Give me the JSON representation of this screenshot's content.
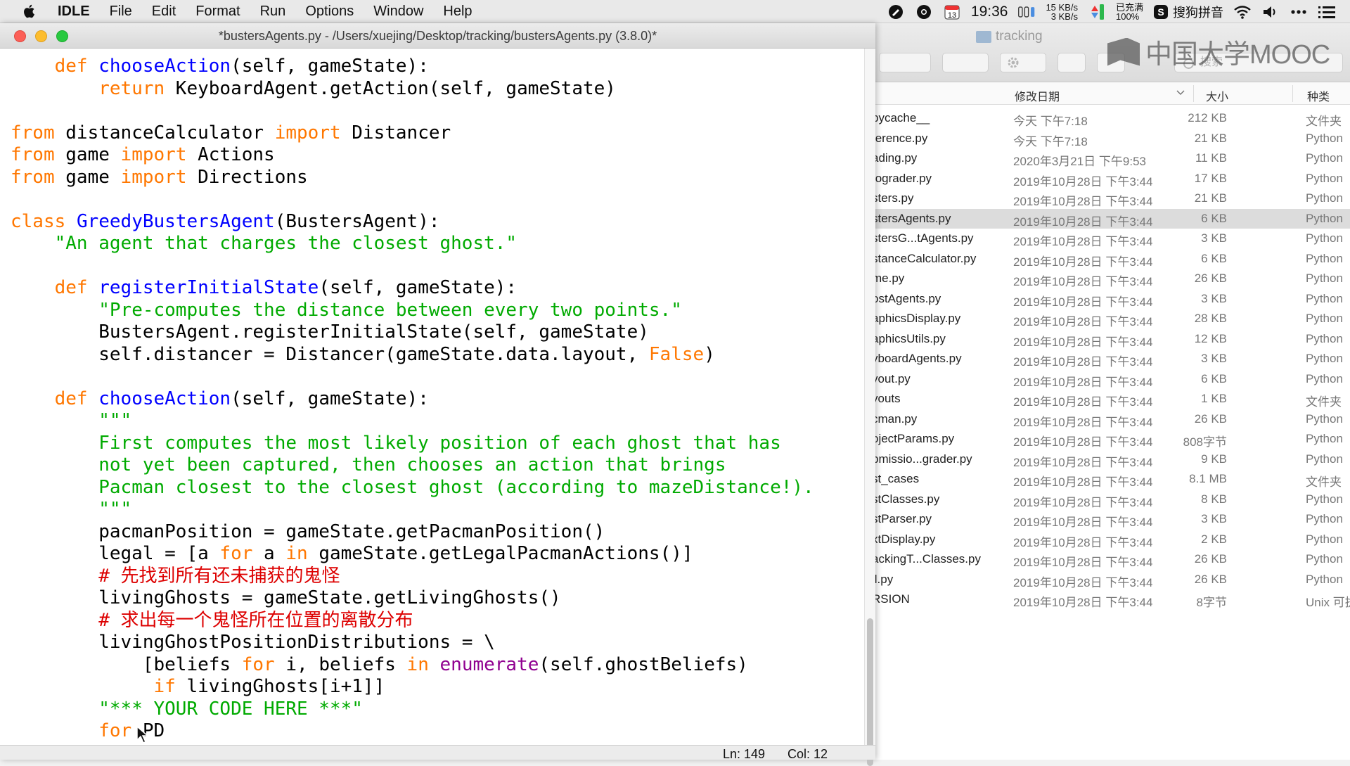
{
  "menubar": {
    "apple_icon": "apple-logo-icon",
    "app_name": "IDLE",
    "menus": [
      "File",
      "Edit",
      "Format",
      "Run",
      "Options",
      "Window",
      "Help"
    ],
    "calendar_day": "13",
    "clock": "19:36",
    "net_up": "15 KB/s",
    "net_down": "3 KB/s",
    "battery_status": "已充满",
    "battery_percent": "100%",
    "ime_label": "搜狗拼音",
    "icons": [
      "pen-icon",
      "chrome-icon",
      "calendar-icon",
      "memory-icon",
      "network-icon",
      "battery-icon",
      "sogou-icon",
      "wifi-icon",
      "volume-icon",
      "more-icon",
      "list-icon"
    ]
  },
  "finder": {
    "title": "tracking",
    "search_placeholder": "搜索",
    "columns": {
      "date": "修改日期",
      "size": "大小",
      "kind": "种类"
    },
    "rows": [
      {
        "name": "pycache__",
        "date": "今天 下午7:18",
        "size": "212 KB",
        "kind": "文件夹"
      },
      {
        "name": "ference.py",
        "date": "今天 下午7:18",
        "size": "21 KB",
        "kind": "Python"
      },
      {
        "name": "ading.py",
        "date": "2020年3月21日 下午9:53",
        "size": "11 KB",
        "kind": "Python"
      },
      {
        "name": "tograder.py",
        "date": "2019年10月28日 下午3:44",
        "size": "17 KB",
        "kind": "Python"
      },
      {
        "name": "sters.py",
        "date": "2019年10月28日 下午3:44",
        "size": "21 KB",
        "kind": "Python"
      },
      {
        "name": "stersAgents.py",
        "date": "2019年10月28日 下午3:44",
        "size": "6 KB",
        "kind": "Python",
        "selected": true
      },
      {
        "name": "stersG...tAgents.py",
        "date": "2019年10月28日 下午3:44",
        "size": "3 KB",
        "kind": "Python"
      },
      {
        "name": "stanceCalculator.py",
        "date": "2019年10月28日 下午3:44",
        "size": "6 KB",
        "kind": "Python"
      },
      {
        "name": "me.py",
        "date": "2019年10月28日 下午3:44",
        "size": "26 KB",
        "kind": "Python"
      },
      {
        "name": "ostAgents.py",
        "date": "2019年10月28日 下午3:44",
        "size": "3 KB",
        "kind": "Python"
      },
      {
        "name": "aphicsDisplay.py",
        "date": "2019年10月28日 下午3:44",
        "size": "28 KB",
        "kind": "Python"
      },
      {
        "name": "aphicsUtils.py",
        "date": "2019年10月28日 下午3:44",
        "size": "12 KB",
        "kind": "Python"
      },
      {
        "name": "yboardAgents.py",
        "date": "2019年10月28日 下午3:44",
        "size": "3 KB",
        "kind": "Python"
      },
      {
        "name": "yout.py",
        "date": "2019年10月28日 下午3:44",
        "size": "6 KB",
        "kind": "Python"
      },
      {
        "name": "youts",
        "date": "2019年10月28日 下午3:44",
        "size": "1 KB",
        "kind": "文件夹"
      },
      {
        "name": "cman.py",
        "date": "2019年10月28日 下午3:44",
        "size": "26 KB",
        "kind": "Python"
      },
      {
        "name": "ojectParams.py",
        "date": "2019年10月28日 下午3:44",
        "size": "808字节",
        "kind": "Python"
      },
      {
        "name": "bmissio...grader.py",
        "date": "2019年10月28日 下午3:44",
        "size": "9 KB",
        "kind": "Python"
      },
      {
        "name": "st_cases",
        "date": "2019年10月28日 下午3:44",
        "size": "8.1 MB",
        "kind": "文件夹"
      },
      {
        "name": "stClasses.py",
        "date": "2019年10月28日 下午3:44",
        "size": "8 KB",
        "kind": "Python"
      },
      {
        "name": "stParser.py",
        "date": "2019年10月28日 下午3:44",
        "size": "3 KB",
        "kind": "Python"
      },
      {
        "name": "xtDisplay.py",
        "date": "2019年10月28日 下午3:44",
        "size": "2 KB",
        "kind": "Python"
      },
      {
        "name": "ackingT...Classes.py",
        "date": "2019年10月28日 下午3:44",
        "size": "26 KB",
        "kind": "Python"
      },
      {
        "name": "il.py",
        "date": "2019年10月28日 下午3:44",
        "size": "26 KB",
        "kind": "Python"
      },
      {
        "name": "RSION",
        "date": "2019年10月28日 下午3:44",
        "size": "8字节",
        "kind": "Unix 可执"
      }
    ]
  },
  "watermark": "中国大学MOOC",
  "idle": {
    "window_title": "*bustersAgents.py - /Users/xuejing/Desktop/tracking/bustersAgents.py (3.8.0)*",
    "status_line": "Ln: 149",
    "status_col": "Col: 12",
    "code": [
      [
        [
          "    ",
          ""
        ],
        [
          "def",
          "kw"
        ],
        [
          " ",
          ""
        ],
        [
          "chooseAction",
          "fn"
        ],
        [
          "(self, gameState):",
          ""
        ]
      ],
      [
        [
          "        ",
          ""
        ],
        [
          "return",
          "kw"
        ],
        [
          " KeyboardAgent.getAction(self, gameState)",
          ""
        ]
      ],
      [],
      [
        [
          "from",
          "kw"
        ],
        [
          " distanceCalculator ",
          ""
        ],
        [
          "import",
          "kw"
        ],
        [
          " Distancer",
          ""
        ]
      ],
      [
        [
          "from",
          "kw"
        ],
        [
          " game ",
          ""
        ],
        [
          "import",
          "kw"
        ],
        [
          " Actions",
          ""
        ]
      ],
      [
        [
          "from",
          "kw"
        ],
        [
          " game ",
          ""
        ],
        [
          "import",
          "kw"
        ],
        [
          " Directions",
          ""
        ]
      ],
      [],
      [
        [
          "class",
          "kw"
        ],
        [
          " ",
          ""
        ],
        [
          "GreedyBustersAgent",
          "fn"
        ],
        [
          "(BustersAgent):",
          ""
        ]
      ],
      [
        [
          "    ",
          ""
        ],
        [
          "\"An agent that charges the closest ghost.\"",
          "st"
        ]
      ],
      [],
      [
        [
          "    ",
          ""
        ],
        [
          "def",
          "kw"
        ],
        [
          " ",
          ""
        ],
        [
          "registerInitialState",
          "fn"
        ],
        [
          "(self, gameState):",
          ""
        ]
      ],
      [
        [
          "        ",
          ""
        ],
        [
          "\"Pre-computes the distance between every two points.\"",
          "st"
        ]
      ],
      [
        [
          "        BustersAgent.registerInitialState(self, gameState)",
          ""
        ]
      ],
      [
        [
          "        self.distancer = Distancer(gameState.data.layout, ",
          ""
        ],
        [
          "False",
          "kw"
        ],
        [
          ")",
          ""
        ]
      ],
      [],
      [
        [
          "    ",
          ""
        ],
        [
          "def",
          "kw"
        ],
        [
          " ",
          ""
        ],
        [
          "chooseAction",
          "fn"
        ],
        [
          "(self, gameState):",
          ""
        ]
      ],
      [
        [
          "        ",
          ""
        ],
        [
          "\"\"\"",
          "st"
        ]
      ],
      [
        [
          "        ",
          ""
        ],
        [
          "First computes the most likely position of each ghost that has",
          "st"
        ]
      ],
      [
        [
          "        ",
          ""
        ],
        [
          "not yet been captured, then chooses an action that brings",
          "st"
        ]
      ],
      [
        [
          "        ",
          ""
        ],
        [
          "Pacman closest to the closest ghost (according to mazeDistance!).",
          "st"
        ]
      ],
      [
        [
          "        ",
          ""
        ],
        [
          "\"\"\"",
          "st"
        ]
      ],
      [
        [
          "        pacmanPosition = gameState.getPacmanPosition()",
          ""
        ]
      ],
      [
        [
          "        legal = [a ",
          ""
        ],
        [
          "for",
          "kw"
        ],
        [
          " a ",
          ""
        ],
        [
          "in",
          "kw"
        ],
        [
          " gameState.getLegalPacmanActions()]",
          ""
        ]
      ],
      [
        [
          "        ",
          ""
        ],
        [
          "# 先找到所有还未捕获的鬼怪",
          "cm"
        ]
      ],
      [
        [
          "        livingGhosts = gameState.getLivingGhosts()",
          ""
        ]
      ],
      [
        [
          "        ",
          ""
        ],
        [
          "# 求出每一个鬼怪所在位置的离散分布",
          "cm"
        ]
      ],
      [
        [
          "        livingGhostPositionDistributions = \\",
          ""
        ]
      ],
      [
        [
          "            [beliefs ",
          ""
        ],
        [
          "for",
          "kw"
        ],
        [
          " i, beliefs ",
          ""
        ],
        [
          "in",
          "kw"
        ],
        [
          " ",
          ""
        ],
        [
          "enumerate",
          "bi"
        ],
        [
          "(self.ghostBeliefs)",
          ""
        ]
      ],
      [
        [
          "             ",
          ""
        ],
        [
          "if",
          "kw"
        ],
        [
          " livingGhosts[i+1]]",
          ""
        ]
      ],
      [
        [
          "        ",
          ""
        ],
        [
          "\"*** YOUR CODE HERE ***\"",
          "st"
        ]
      ],
      [
        [
          "        ",
          ""
        ],
        [
          "for",
          "kw"
        ],
        [
          " PD",
          ""
        ]
      ]
    ]
  }
}
